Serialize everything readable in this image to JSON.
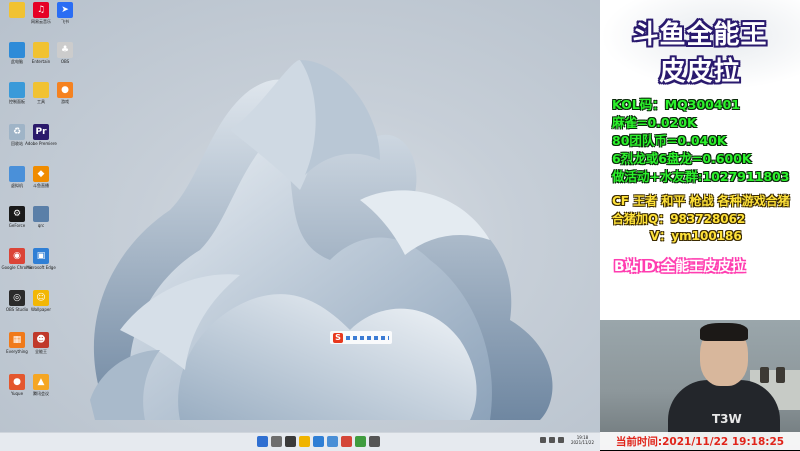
{
  "desktop": {
    "icons": [
      {
        "label": "",
        "color": "#f1c232",
        "glyph": ""
      },
      {
        "label": "网易云音乐",
        "color": "#e60026",
        "glyph": "♫"
      },
      {
        "label": "飞书",
        "color": "#2a6df4",
        "glyph": "➤"
      },
      {
        "label": "此电脑",
        "color": "#2e8bd8",
        "glyph": ""
      },
      {
        "label": "Entertain",
        "color": "#f1c232",
        "glyph": ""
      },
      {
        "label": "OBS",
        "color": "#cccccc",
        "glyph": "♣"
      },
      {
        "label": "控制面板",
        "color": "#3a9ad9",
        "glyph": ""
      },
      {
        "label": "工具",
        "color": "#f1c232",
        "glyph": ""
      },
      {
        "label": "游戏",
        "color": "#f58220",
        "glyph": "●"
      },
      {
        "label": "回收站",
        "color": "#9fb4c7",
        "glyph": "♻"
      },
      {
        "label": "Adobe Premiere",
        "color": "#2b1a6b",
        "glyph": "Pr"
      },
      {
        "label": "虚拟机",
        "color": "#4a90d9",
        "glyph": ""
      },
      {
        "label": "斗鱼直播",
        "color": "#f08c00",
        "glyph": "◆"
      },
      {
        "label": "GeForce",
        "color": "#1a1a1a",
        "glyph": "⚙"
      },
      {
        "label": "qrc",
        "color": "#5a7fa8",
        "glyph": ""
      },
      {
        "label": "Google Chrome",
        "color": "#db4437",
        "glyph": "◉"
      },
      {
        "label": "Microsoft Edge",
        "color": "#2f7fd5",
        "glyph": "▣"
      },
      {
        "label": "OBS Studio",
        "color": "#2b2b2b",
        "glyph": "◎"
      },
      {
        "label": "Wallpaper",
        "color": "#f2b705",
        "glyph": "☺"
      },
      {
        "label": "Everything",
        "color": "#f07a1a",
        "glyph": "▦"
      },
      {
        "label": "全能王",
        "color": "#c0392b",
        "glyph": "☻"
      },
      {
        "label": "Yuque",
        "color": "#e4572e",
        "glyph": "●"
      },
      {
        "label": "腾讯会议",
        "color": "#f5a623",
        "glyph": "▲"
      }
    ],
    "taskbar": {
      "clock_time": "19:18",
      "clock_date": "2021/11/22",
      "app_colors": [
        "#2f6fd1",
        "#6e6e6e",
        "#3a3a3a",
        "#f0b400",
        "#2f7fd5",
        "#4a8fd6",
        "#d44638",
        "#3f9c3f",
        "#555555"
      ]
    }
  },
  "panel": {
    "brand_line1": "斗鱼全能王",
    "brand_line2": "皮皮拉",
    "kol_code": "KOL码：MQ300401",
    "mahjong": "麻雀=0.020K",
    "team_coin": "80团队币=0.040K",
    "dragon": "6烈龙或6盘龙=0.600K",
    "activity": "做活动+水友群:1027911803",
    "games": "CF 王者 和平 枪战 各种游戏合猪",
    "qq": "合猪加Q：983728062",
    "wechat": "V：ym100186",
    "bilibili": "B站ID:全能王皮皮拉"
  },
  "webcam": {
    "shirt_text": "T3W"
  },
  "timebar": {
    "current_time": "当前时间:2021/11/22 19:18:25"
  },
  "colors": {
    "brand_outline": "#2a1a6e",
    "info_green": "#2cf22c",
    "info_yellow": "#ffe23a",
    "bili_pink": "#ff3db0",
    "time_red": "#e0241a"
  }
}
